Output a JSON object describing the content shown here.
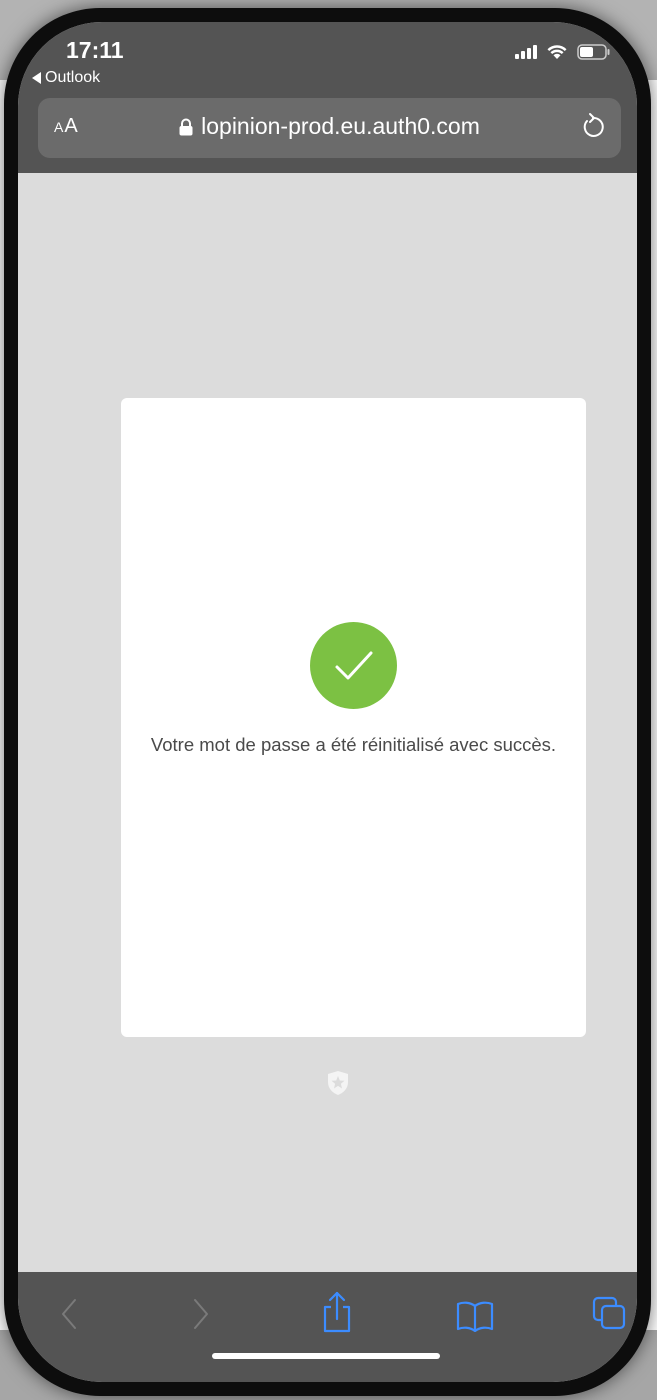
{
  "status_bar": {
    "time": "17:11",
    "back_app": "Outlook"
  },
  "browser": {
    "text_size_button": {
      "small": "A",
      "large": "A"
    },
    "domain": "lopinion-prod.eu.auth0.com",
    "icons": {
      "lock": "lock-icon",
      "reload": "reload-icon"
    }
  },
  "page": {
    "message": "Votre mot de passe a été réinitialisé avec succès.",
    "success_icon": "checkmark-icon",
    "success_color": "#7cc143",
    "footer_logo": "auth0-badge-icon"
  },
  "toolbar": {
    "items": [
      "back-icon",
      "forward-icon",
      "share-icon",
      "bookmarks-icon",
      "tabs-icon"
    ],
    "accent": "#3c8cff",
    "disabled_color": "#7a7a7a"
  }
}
